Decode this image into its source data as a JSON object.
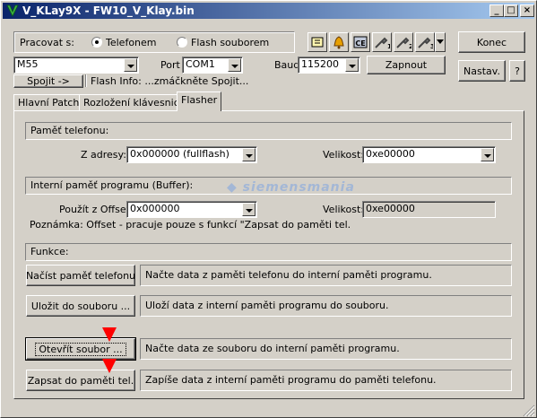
{
  "window": {
    "title": "V_KLay9X - FW10_V_Klay.bin",
    "minimize_glyph": "_",
    "maximize_glyph": "□",
    "close_glyph": "×"
  },
  "connection": {
    "pracovat_label": "Pracovat s:",
    "radio_phone_label": "Telefonem",
    "radio_file_label": "Flash souborem",
    "radio_phone_checked": true,
    "model_value": "M55",
    "port_label": "Port",
    "port_value": "COM1",
    "baud_label": "Baud",
    "baud_value": "115200",
    "zapnout_label": "Zapnout",
    "spojit_label": "Spojit ->",
    "flash_info_text": "Flash Info: ...zmáčkněte Spojit...",
    "konec_label": "Konec",
    "nastav_label": "Nastav.",
    "help_label": "?"
  },
  "toolbar": {
    "icons": [
      "phone-book-icon",
      "bell-icon",
      "ce-icon",
      "tools-1-icon",
      "tools-2-icon",
      "tools-3-icon"
    ],
    "tool_numbers": [
      "1",
      "2",
      "3"
    ],
    "ce_text": "CE"
  },
  "tabs": [
    {
      "label": "Hlavní Patch"
    },
    {
      "label": "Rozložení klávesnice"
    },
    {
      "label": "Flasher"
    }
  ],
  "flasher": {
    "phone_memory_header": "Paměť telefonu:",
    "z_adresy_label": "Z adresy:",
    "z_adresy_value": "0x000000 (fullflash)",
    "velikost_label": "Velikost:",
    "velikost_value": "0xe00000",
    "buffer_header": "Interní paměť programu (Buffer):",
    "offset_label": "Použít z Offsetu:",
    "offset_value": "0x000000",
    "velikost2_label": "Velikost:",
    "velikost2_value": "0xe00000",
    "poznamka": "Poznámka: Offset - pracuje pouze s funkcí \"Zapsat do paměti tel.",
    "funkce_header": "Funkce:",
    "actions": [
      {
        "button": "Načíst paměť telefonu",
        "desc": "Načte data z paměti telefonu do interní paměti programu."
      },
      {
        "button": "Uložit do souboru ...",
        "desc": "Uloží data z interní paměti programu do souboru."
      },
      {
        "button": "Otevřít soubor ...",
        "desc": "Načte data ze souboru do interní paměti programu."
      },
      {
        "button": "Zapsat do paměti tel.",
        "desc": "Zapíše data z interní paměti programu do paměti telefonu."
      }
    ]
  },
  "watermark": "siemensmania",
  "colors": {
    "title_start": "#0a246a",
    "title_end": "#a6caf0",
    "face": "#d4d0c8",
    "arrow": "#ff0000"
  }
}
